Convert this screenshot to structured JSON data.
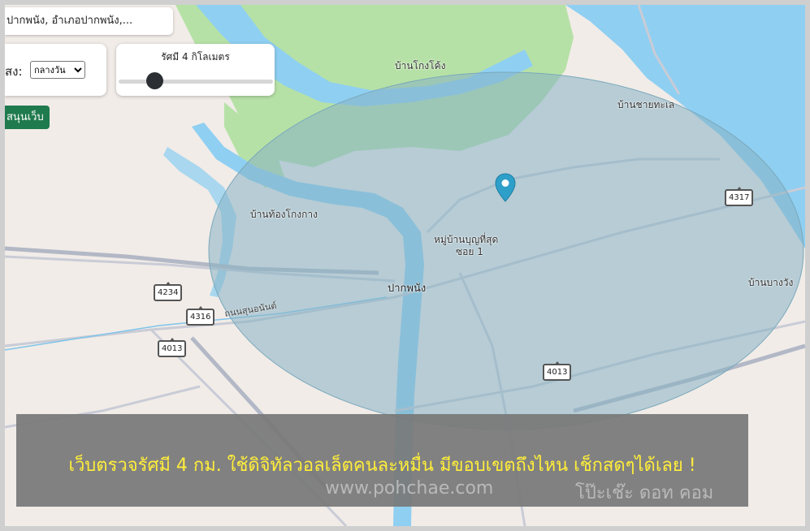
{
  "search": {
    "value": "ปากพนัง, อำเภอปากพนัง,..."
  },
  "mode": {
    "label": "สง:",
    "selected": "กลางวัน"
  },
  "radius": {
    "title": "รัศมี 4 กิโลเมตร",
    "slider_fraction": 0.2
  },
  "support": {
    "label": "สนุนเว็บ"
  },
  "map": {
    "places": {
      "a": "บ้านโกงโค้ง",
      "b": "บ้านชายทะเล",
      "c": "บ้านท้องโกงกาง",
      "d": "หมู่บ้านบุญที่สุด",
      "d2": "ซอย 1",
      "e": "ปากพนัง",
      "f": "บ้านบางวัง"
    },
    "road_name": "ถนนสุนอนันต์",
    "routes": {
      "r1": "4317",
      "r2": "4234",
      "r3": "4316",
      "r4": "4013",
      "r5": "4013"
    },
    "colors": {
      "water": "#8fcff2",
      "land": "#f1ece8",
      "green": "#b6e1a6",
      "circle": "#87b3c4",
      "pin": "#2e9fc9"
    }
  },
  "banner": {
    "headline": "เว็บตรวจรัศมี 4 กม. ใช้ดิจิทัลวอลเล็ตคนละหมื่น มีขอบเขตถึงไหน เช็กสดๆได้เลย !",
    "url": "www.pohchae.com",
    "brand": "โป๊ะเช๊ะ ดอท คอม"
  }
}
